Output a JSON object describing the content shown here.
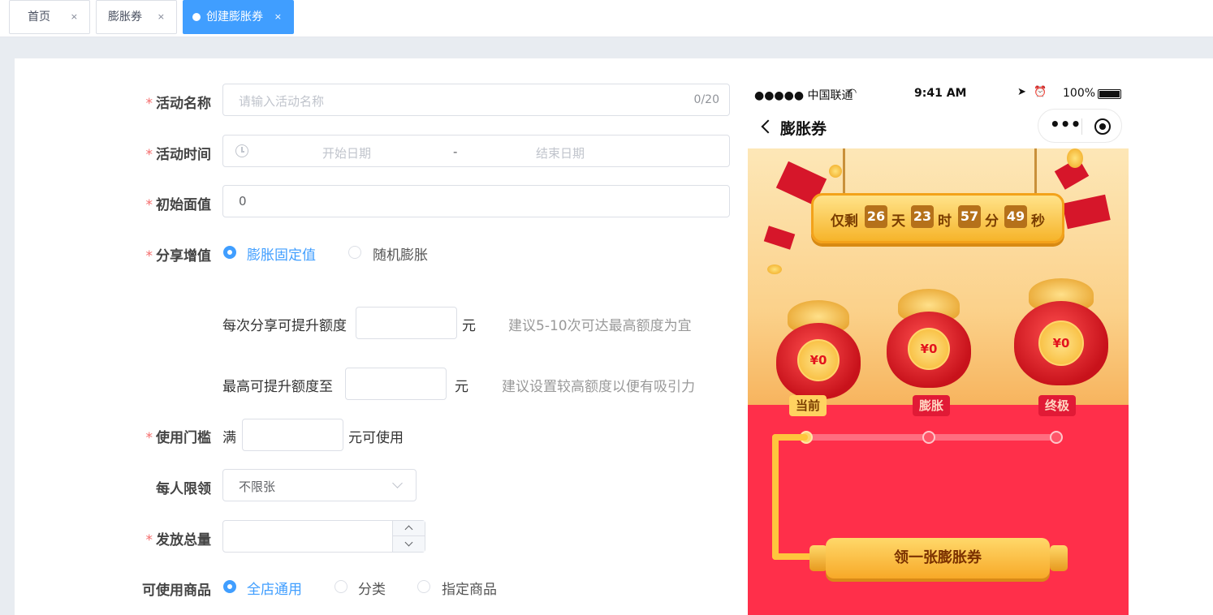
{
  "tabs": [
    {
      "label": "首页",
      "close": "×"
    },
    {
      "label": "膨胀券",
      "close": "×"
    },
    {
      "label": "创建膨胀券",
      "close": "×"
    }
  ],
  "form": {
    "activity_name": {
      "label": "活动名称",
      "placeholder": "请输入活动名称",
      "counter": "0/20"
    },
    "activity_time": {
      "label": "活动时间",
      "start_placeholder": "开始日期",
      "separator": "-",
      "end_placeholder": "结束日期"
    },
    "initial_value": {
      "label": "初始面值",
      "value": "0"
    },
    "share_increase": {
      "label": "分享增值",
      "options": [
        "膨胀固定值",
        "随机膨胀"
      ],
      "selected": "膨胀固定值"
    },
    "per_share": {
      "label": "每次分享可提升额度",
      "unit": "元",
      "hint": "建议5-10次可达最高额度为宜"
    },
    "max_increase": {
      "label": "最高可提升额度至",
      "unit": "元",
      "hint": "建议设置较高额度以便有吸引力"
    },
    "threshold": {
      "label": "使用门槛",
      "prefix": "满",
      "suffix": "元可使用"
    },
    "per_person": {
      "label": "每人限领",
      "value": "不限张"
    },
    "total": {
      "label": "发放总量"
    },
    "products": {
      "label": "可使用商品",
      "options": [
        "全店通用",
        "分类",
        "指定商品"
      ],
      "selected": "全店通用"
    },
    "required_mark": "*"
  },
  "phone": {
    "carrier": "●●●●● 中国联通",
    "time": "9:41 AM",
    "battery": "100%",
    "title": "膨胀券",
    "countdown": {
      "prefix": "仅剩",
      "days": "26",
      "day_unit": "天",
      "hours": "23",
      "hour_unit": "时",
      "minutes": "57",
      "minute_unit": "分",
      "seconds": "49",
      "second_unit": "秒"
    },
    "bags": [
      {
        "amount": "¥0",
        "label": "当前"
      },
      {
        "amount": "¥0",
        "label": "膨胀"
      },
      {
        "amount": "¥0",
        "label": "终极"
      }
    ],
    "claim_button": "领一张膨胀券"
  },
  "colors": {
    "accent": "#409eff",
    "required": "#f56c6c",
    "stage_red": "#ff2f4a"
  }
}
